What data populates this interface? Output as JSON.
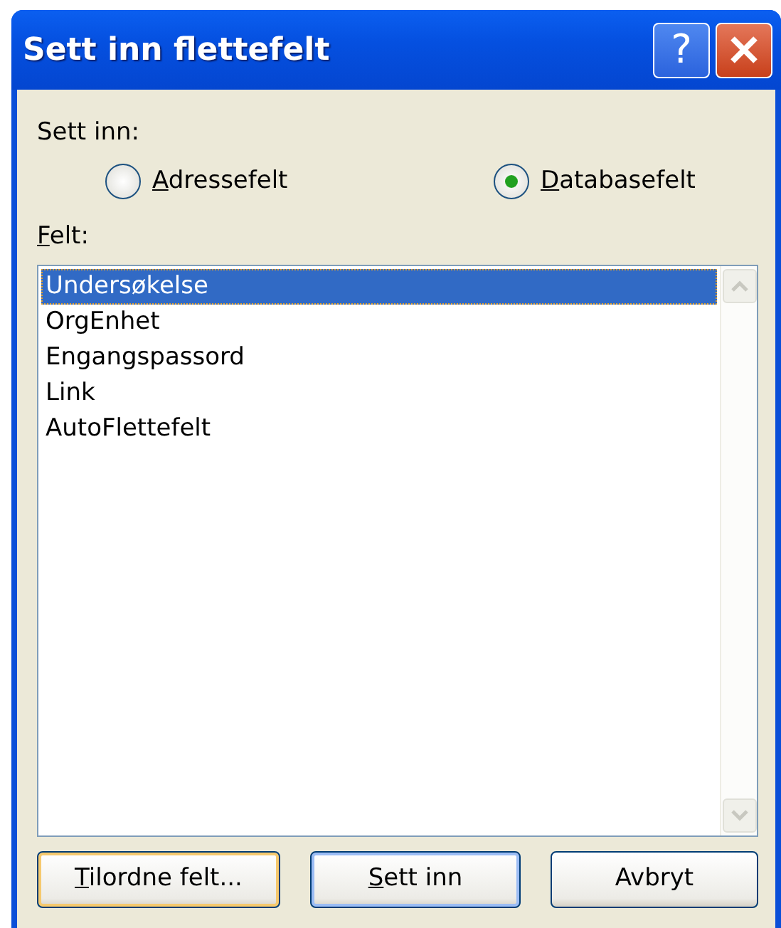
{
  "window": {
    "title": "Sett inn flettefelt",
    "title_buttons": [
      {
        "kind": "help",
        "label": "?"
      },
      {
        "kind": "close"
      }
    ]
  },
  "insert_group": {
    "label": "Sett inn:",
    "options": [
      {
        "label": "Adressefelt",
        "mnemonic": true,
        "selected": false
      },
      {
        "label": "Databasefelt",
        "mnemonic": true,
        "selected": true
      }
    ]
  },
  "fields": {
    "label": "Felt:",
    "mnemonic": true,
    "items": [
      {
        "label": "Undersøkelse",
        "selected": true
      },
      {
        "label": "OrgEnhet",
        "selected": false
      },
      {
        "label": "Engangspassord",
        "selected": false
      },
      {
        "label": "Link",
        "selected": false
      },
      {
        "label": "AutoFlettefelt",
        "selected": false
      }
    ]
  },
  "buttons": [
    {
      "label": "Tilordne felt...",
      "mnemonic": true,
      "focused": true,
      "default": false
    },
    {
      "label": "Sett inn",
      "mnemonic": true,
      "focused": false,
      "default": true
    },
    {
      "label": "Avbryt",
      "mnemonic": false,
      "focused": false,
      "default": false
    }
  ]
}
